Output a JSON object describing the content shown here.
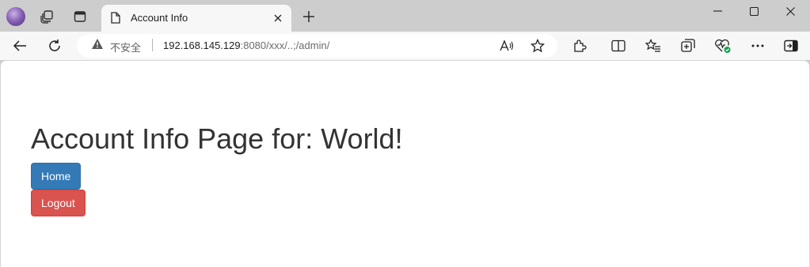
{
  "browser": {
    "tab_title": "Account Info",
    "security_label": "不安全",
    "url_host": "192.168.145.129",
    "url_rest": ":8080/xxx/..;/admin/"
  },
  "page": {
    "heading": "Account Info Page for: World!",
    "home_label": "Home",
    "logout_label": "Logout",
    "colors": {
      "home": "#337ab7",
      "logout": "#d9534f"
    }
  },
  "icons": [
    "profile-avatar",
    "workspaces-icon",
    "tab-actions-icon",
    "page-icon",
    "close-icon",
    "new-tab-icon",
    "minimize-icon",
    "maximize-icon",
    "window-close-icon",
    "back-icon",
    "refresh-icon",
    "warning-icon",
    "read-aloud-icon",
    "favorite-star-icon",
    "extensions-icon",
    "split-screen-icon",
    "favorites-icon",
    "collections-icon",
    "browser-essentials-icon",
    "more-icon",
    "sidebar-icon"
  ]
}
